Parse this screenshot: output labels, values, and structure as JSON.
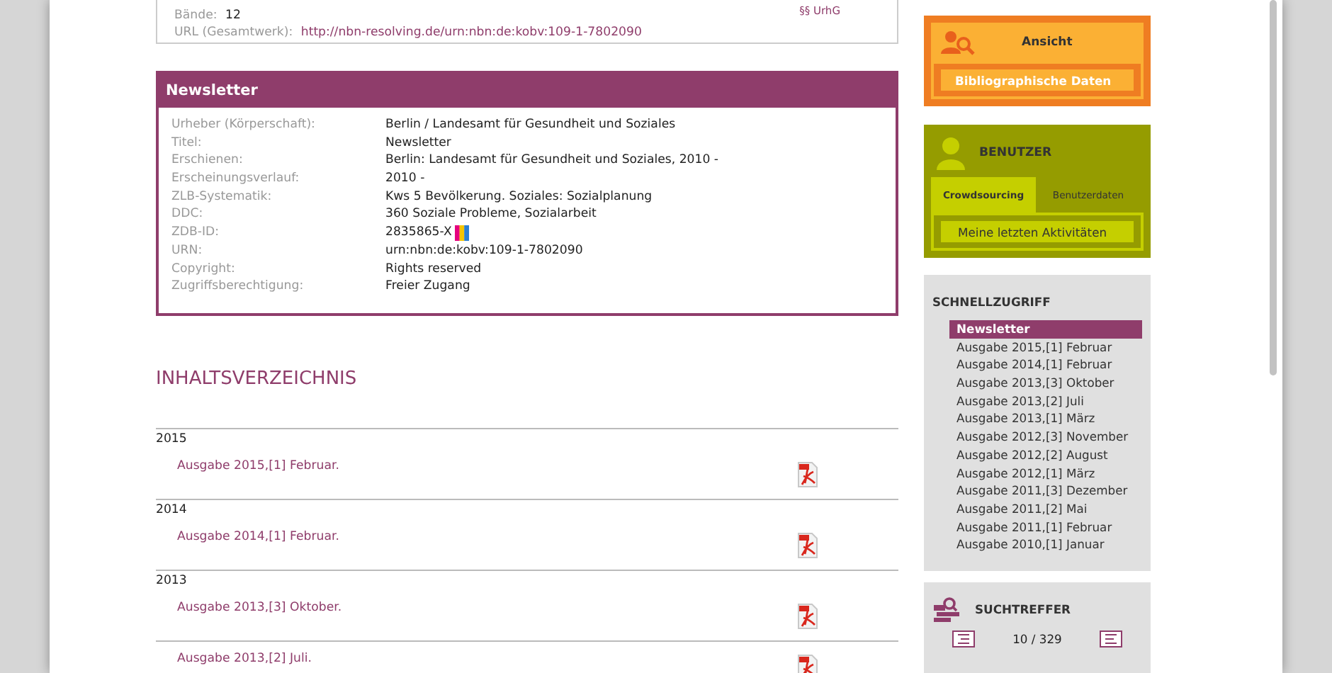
{
  "record_box": {
    "fields": [
      {
        "label": "Bände:",
        "value": "12",
        "kind": "text"
      },
      {
        "label": "URL (Gesamtwerk):",
        "value": "http://nbn-resolving.de/urn:nbn:de:kobv:109-1-7802090",
        "kind": "link"
      }
    ],
    "rights_link": "§§ UrhG"
  },
  "newsletter": {
    "title": "Newsletter",
    "fields": [
      {
        "label": "Urheber (Körperschaft):",
        "value": "Berlin / Landesamt für Gesundheit und Soziales",
        "kind": "text"
      },
      {
        "label": "Titel:",
        "value": "Newsletter",
        "kind": "text"
      },
      {
        "label": "Erschienen:",
        "value": "Berlin: Landesamt für Gesundheit und Soziales, 2010 -",
        "kind": "text"
      },
      {
        "label": "Erscheinungsverlauf:",
        "value": "2010 -",
        "kind": "text"
      },
      {
        "label": "ZLB-Systematik:",
        "value": "Kws 5 Bevölkerung. Soziales: Sozialplanung",
        "kind": "text"
      },
      {
        "label": "DDC:",
        "value": "360 Soziale Probleme, Sozialarbeit",
        "kind": "text"
      },
      {
        "label": "ZDB-ID:",
        "value": "2835865-X",
        "kind": "zdb"
      },
      {
        "label": "URN:",
        "value": "urn:nbn:de:kobv:109-1-7802090",
        "kind": "text"
      },
      {
        "label": "Copyright:",
        "value": "Rights reserved",
        "kind": "text"
      },
      {
        "label": "Zugriffsberechtigung:",
        "value": "Freier Zugang",
        "kind": "text"
      }
    ]
  },
  "contents": {
    "title": "INHALTSVERZEICHNIS",
    "groups": [
      {
        "year": "2015",
        "items": [
          "Ausgabe 2015,[1] Februar."
        ]
      },
      {
        "year": "2014",
        "items": [
          "Ausgabe 2014,[1] Februar."
        ]
      },
      {
        "year": "2013",
        "items": [
          "Ausgabe 2013,[3] Oktober.",
          "Ausgabe 2013,[2] Juli."
        ]
      }
    ]
  },
  "sidebar": {
    "view": {
      "title": "Ansicht",
      "buttons": [
        "Bibliographische Daten"
      ]
    },
    "user": {
      "title": "BENUTZER",
      "tabs": [
        {
          "label": "Crowdsourcing",
          "selected": true
        },
        {
          "label": "Benutzerdaten",
          "selected": false
        }
      ],
      "links": [
        "Meine letzten Aktivitäten"
      ]
    },
    "quick_access": {
      "title": "SCHNELLZUGRIFF",
      "items": [
        {
          "label": "Newsletter",
          "selected": true
        },
        {
          "label": "Ausgabe 2015,[1] Februar",
          "selected": false
        },
        {
          "label": "Ausgabe 2014,[1] Februar",
          "selected": false
        },
        {
          "label": "Ausgabe 2013,[3] Oktober",
          "selected": false
        },
        {
          "label": "Ausgabe 2013,[2] Juli",
          "selected": false
        },
        {
          "label": "Ausgabe 2013,[1] März",
          "selected": false
        },
        {
          "label": "Ausgabe 2012,[3] November",
          "selected": false
        },
        {
          "label": "Ausgabe 2012,[2] August",
          "selected": false
        },
        {
          "label": "Ausgabe 2012,[1] März",
          "selected": false
        },
        {
          "label": "Ausgabe 2011,[3] Dezember",
          "selected": false
        },
        {
          "label": "Ausgabe 2011,[2] Mai",
          "selected": false
        },
        {
          "label": "Ausgabe 2011,[1] Februar",
          "selected": false
        },
        {
          "label": "Ausgabe 2010,[1] Januar",
          "selected": false
        }
      ]
    },
    "search_hits": {
      "title": "SUCHTREFFER",
      "counter": "10 / 329"
    }
  }
}
